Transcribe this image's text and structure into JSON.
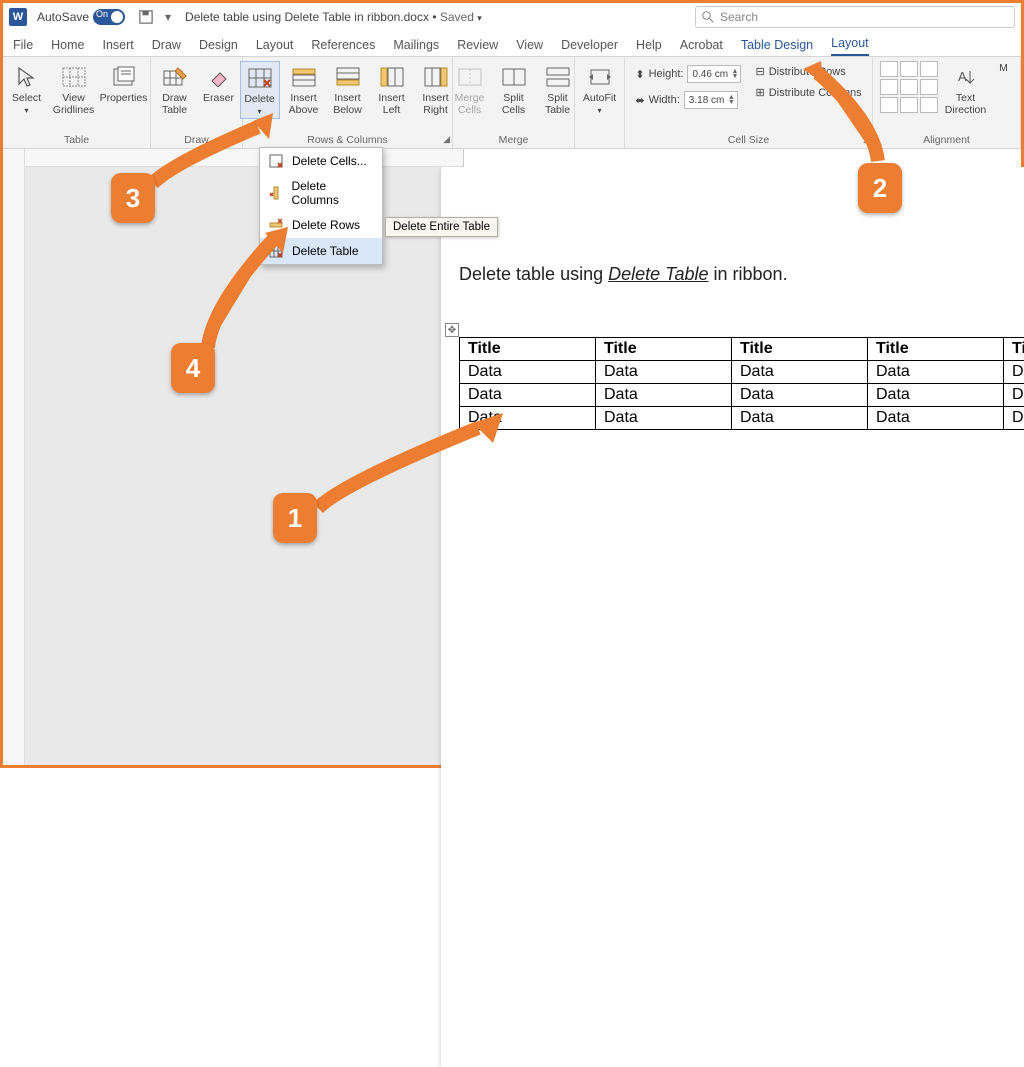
{
  "title": {
    "autosave_label": "AutoSave",
    "autosave_state": "On",
    "doc_name": "Delete table using Delete Table in ribbon.docx",
    "doc_state": "Saved",
    "search_placeholder": "Search"
  },
  "tabs": {
    "file": "File",
    "home": "Home",
    "insert": "Insert",
    "draw": "Draw",
    "design": "Design",
    "layout": "Layout",
    "references": "References",
    "mailings": "Mailings",
    "review": "Review",
    "view": "View",
    "developer": "Developer",
    "help": "Help",
    "acrobat": "Acrobat",
    "table_design": "Table Design",
    "table_layout": "Layout"
  },
  "ribbon": {
    "groups": {
      "table": "Table",
      "draw": "Draw",
      "rows_cols": "Rows & Columns",
      "merge": "Merge",
      "cell_size": "Cell Size",
      "alignment": "Alignment"
    },
    "select": "Select",
    "view_gridlines": "View Gridlines",
    "properties": "Properties",
    "draw_table": "Draw Table",
    "eraser": "Eraser",
    "delete": "Delete",
    "insert_above": "Insert Above",
    "insert_below": "Insert Below",
    "insert_left": "Insert Left",
    "insert_right": "Insert Right",
    "merge_cells": "Merge Cells",
    "split_cells": "Split Cells",
    "split_table": "Split Table",
    "autofit": "AutoFit",
    "height_label": "Height:",
    "height_val": "0.46 cm",
    "width_label": "Width:",
    "width_val": "3.18 cm",
    "dist_rows": "Distribute Rows",
    "dist_cols": "Distribute Columns",
    "text_direction": "Text Direction",
    "cell_margins": "M"
  },
  "delete_menu": {
    "cells": "Delete Cells...",
    "columns": "Delete Columns",
    "rows": "Delete Rows",
    "table": "Delete Table",
    "tooltip": "Delete Entire Table"
  },
  "page": {
    "headline_pre": "Delete table using ",
    "headline_em": "Delete Table",
    "headline_post": " in ribbon.",
    "table": {
      "headers": [
        "Title",
        "Title",
        "Title",
        "Title",
        "Title"
      ],
      "rows": [
        [
          "Data",
          "Data",
          "Data",
          "Data",
          "Data"
        ],
        [
          "Data",
          "Data",
          "Data",
          "Data",
          "Data"
        ],
        [
          "Data",
          "Data",
          "Data",
          "Data",
          "Data"
        ]
      ]
    }
  },
  "annotations": {
    "a1": "1",
    "a2": "2",
    "a3": "3",
    "a4": "4"
  }
}
